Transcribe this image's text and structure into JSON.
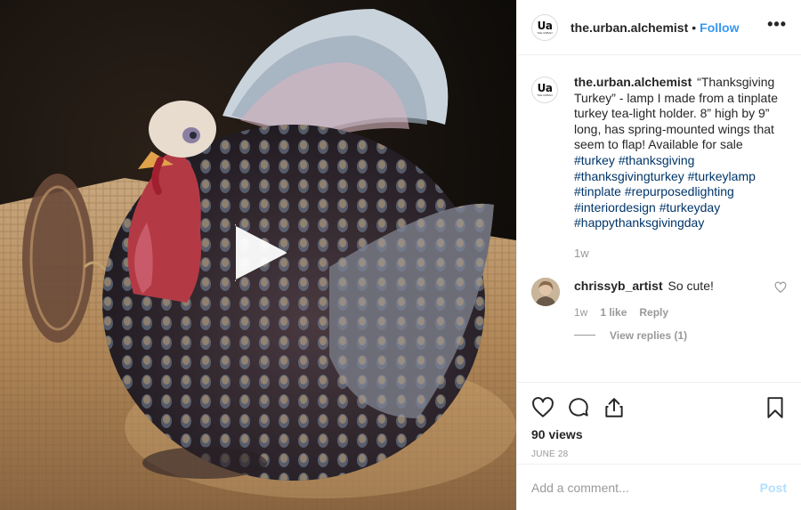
{
  "post": {
    "username": "the.urban.alchemist",
    "avatar_text": "Ua",
    "avatar_subtext": "THE URBAN",
    "separator": "•",
    "follow_label": "Follow",
    "more_label": "•••",
    "media": {
      "play_icon": "play-icon"
    },
    "caption": {
      "username": "the.urban.alchemist",
      "text": "“Thanksgiving Turkey” - lamp I made from a tinplate turkey tea-light holder. 8” high by 9” long, has spring-mounted wings that seem to flap! Available for sale",
      "hashtags": [
        "#turkey",
        "#thanksgiving",
        "#thanksgivingturkey",
        "#turkeylamp",
        "#tinplate",
        "#repurposedlighting",
        "#interiordesign",
        "#turkeyday",
        "#happythanksgivingday"
      ],
      "time": "1w"
    },
    "comments": [
      {
        "username": "chrissyb_artist",
        "text": "So cute!",
        "time": "1w",
        "likes": "1 like",
        "reply_label": "Reply",
        "view_replies": "View replies (1)"
      }
    ],
    "actions": {
      "like_icon": "heart-icon",
      "comment_icon": "comment-icon",
      "share_icon": "share-icon",
      "save_icon": "bookmark-icon"
    },
    "views": "90 views",
    "date": "JUNE 28",
    "add_comment": {
      "placeholder": "Add a comment...",
      "post_label": "Post"
    }
  }
}
